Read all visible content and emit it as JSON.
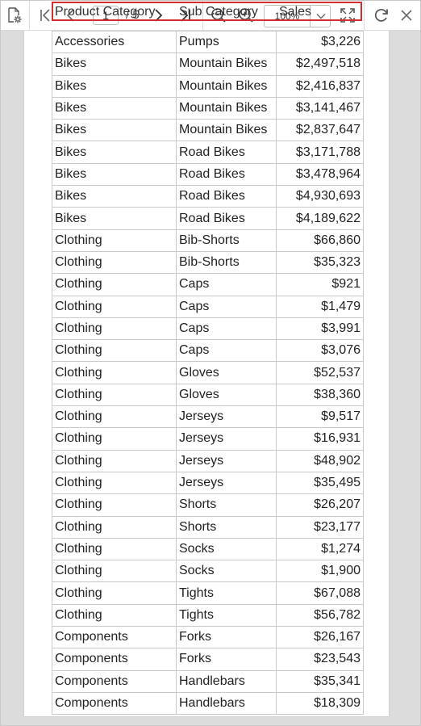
{
  "toolbar": {
    "current_page": "1",
    "total_pages": "/ 5",
    "zoom": "100%"
  },
  "report": {
    "headers": [
      "Product Category",
      "Sub Category",
      "Sales"
    ],
    "rows": [
      [
        "Accessories",
        "Pumps",
        "$3,226"
      ],
      [
        "Bikes",
        "Mountain Bikes",
        "$2,497,518"
      ],
      [
        "Bikes",
        "Mountain Bikes",
        "$2,416,837"
      ],
      [
        "Bikes",
        "Mountain Bikes",
        "$3,141,467"
      ],
      [
        "Bikes",
        "Mountain Bikes",
        "$2,837,647"
      ],
      [
        "Bikes",
        "Road Bikes",
        "$3,171,788"
      ],
      [
        "Bikes",
        "Road Bikes",
        "$3,478,964"
      ],
      [
        "Bikes",
        "Road Bikes",
        "$4,930,693"
      ],
      [
        "Bikes",
        "Road Bikes",
        "$4,189,622"
      ],
      [
        "Clothing",
        "Bib-Shorts",
        "$66,860"
      ],
      [
        "Clothing",
        "Bib-Shorts",
        "$35,323"
      ],
      [
        "Clothing",
        "Caps",
        "$921"
      ],
      [
        "Clothing",
        "Caps",
        "$1,479"
      ],
      [
        "Clothing",
        "Caps",
        "$3,991"
      ],
      [
        "Clothing",
        "Caps",
        "$3,076"
      ],
      [
        "Clothing",
        "Gloves",
        "$52,537"
      ],
      [
        "Clothing",
        "Gloves",
        "$38,360"
      ],
      [
        "Clothing",
        "Jerseys",
        "$9,517"
      ],
      [
        "Clothing",
        "Jerseys",
        "$16,931"
      ],
      [
        "Clothing",
        "Jerseys",
        "$48,902"
      ],
      [
        "Clothing",
        "Jerseys",
        "$35,495"
      ],
      [
        "Clothing",
        "Shorts",
        "$26,207"
      ],
      [
        "Clothing",
        "Shorts",
        "$23,177"
      ],
      [
        "Clothing",
        "Socks",
        "$1,274"
      ],
      [
        "Clothing",
        "Socks",
        "$1,900"
      ],
      [
        "Clothing",
        "Tights",
        "$67,088"
      ],
      [
        "Clothing",
        "Tights",
        "$56,782"
      ],
      [
        "Components",
        "Forks",
        "$26,167"
      ],
      [
        "Components",
        "Forks",
        "$23,543"
      ],
      [
        "Components",
        "Handlebars",
        "$35,341"
      ],
      [
        "Components",
        "Handlebars",
        "$18,309"
      ]
    ]
  },
  "icons": {
    "export": "export-settings-icon",
    "first": "first-page-icon",
    "prev": "previous-page-icon",
    "next": "next-page-icon",
    "last": "last-page-icon",
    "zoom_out": "zoom-out-icon",
    "zoom_in": "zoom-in-icon",
    "fit": "fit-page-icon",
    "refresh": "refresh-icon",
    "close": "close-icon"
  },
  "colors": {
    "selection": "#d32f2f",
    "viewer_background": "#dcdcdc"
  }
}
